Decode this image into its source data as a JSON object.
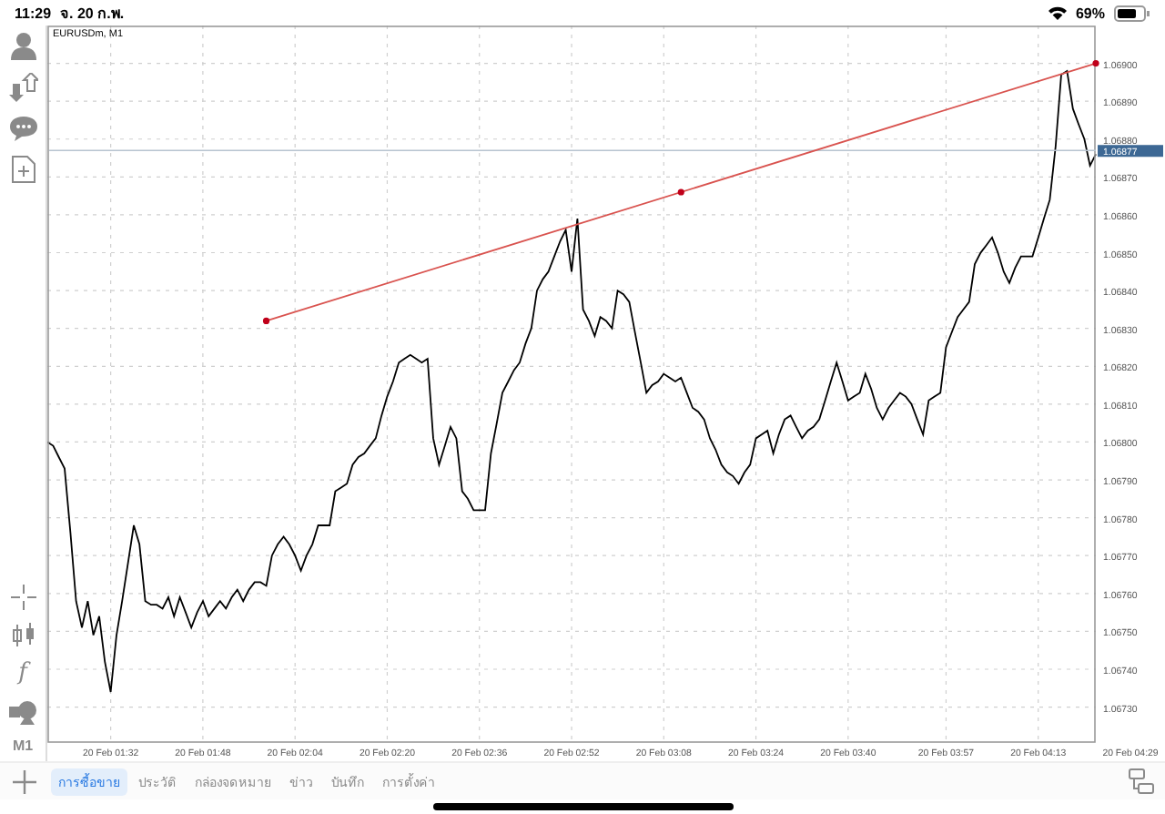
{
  "status_bar": {
    "time": "11:29",
    "date": "จ. 20 ก.พ.",
    "battery": "69%"
  },
  "toolbar": {
    "function_label": "f",
    "timeframe": "M1"
  },
  "chart": {
    "symbol": "EURUSDm, M1",
    "current_price": "1.06877",
    "trendline": {
      "kind": "trendline"
    },
    "chart_data": {
      "type": "line",
      "ylim": [
        1.06721,
        1.0691
      ],
      "grid": true,
      "categories": [
        null,
        null,
        null,
        null,
        null,
        null,
        null,
        null,
        null,
        null,
        null,
        "20 Feb 01:32",
        null,
        null,
        null,
        null,
        null,
        null,
        null,
        null,
        null,
        null,
        null,
        null,
        null,
        null,
        null,
        "20 Feb 01:48",
        null,
        null,
        null,
        null,
        null,
        null,
        null,
        null,
        null,
        null,
        null,
        null,
        null,
        null,
        null,
        "20 Feb 02:04",
        null,
        null,
        null,
        null,
        null,
        null,
        null,
        null,
        null,
        null,
        null,
        null,
        null,
        null,
        null,
        "20 Feb 02:20",
        null,
        null,
        null,
        null,
        null,
        null,
        null,
        null,
        null,
        null,
        null,
        null,
        null,
        null,
        null,
        "20 Feb 02:36",
        null,
        null,
        null,
        null,
        null,
        null,
        null,
        null,
        null,
        null,
        null,
        null,
        null,
        null,
        null,
        "20 Feb 02:52",
        null,
        null,
        null,
        null,
        null,
        null,
        null,
        null,
        null,
        null,
        null,
        null,
        null,
        null,
        null,
        "20 Feb 03:08",
        null,
        null,
        null,
        null,
        null,
        null,
        null,
        null,
        null,
        null,
        null,
        null,
        null,
        null,
        null,
        "20 Feb 03:24",
        null,
        null,
        null,
        null,
        null,
        null,
        null,
        null,
        null,
        null,
        null,
        null,
        null,
        null,
        null,
        "20 Feb 03:40",
        null,
        null,
        null,
        null,
        null,
        null,
        null,
        null,
        null,
        null,
        null,
        null,
        null,
        null,
        null,
        null,
        "20 Feb 03:57",
        null,
        null,
        null,
        null,
        null,
        null,
        null,
        null,
        null,
        null,
        null,
        null,
        null,
        null,
        null,
        "20 Feb 04:13",
        null,
        null,
        null,
        null,
        null,
        null,
        null,
        null,
        null,
        null,
        null,
        null,
        null,
        null,
        null,
        "20 Feb 04:29"
      ],
      "series": [
        {
          "color": "#000000",
          "values": [
            1.068,
            1.06799,
            1.06796,
            1.06793,
            1.06776,
            1.06758,
            1.06751,
            1.06758,
            1.06749,
            1.06754,
            1.06742,
            1.06734,
            1.06749,
            1.06758,
            1.06768,
            1.06778,
            1.06773,
            1.06758,
            1.06757,
            1.06757,
            1.06756,
            1.06759,
            1.06754,
            1.06759,
            1.06755,
            1.06751,
            1.06755,
            1.06758,
            1.06754,
            1.06756,
            1.06758,
            1.06756,
            1.06759,
            1.06761,
            1.06758,
            1.06761,
            1.06763,
            1.06763,
            1.06762,
            1.0677,
            1.06773,
            1.06775,
            1.06773,
            1.0677,
            1.06766,
            1.0677,
            1.06773,
            1.06778,
            1.06778,
            1.06778,
            1.06787,
            1.06788,
            1.06789,
            1.06794,
            1.06796,
            1.06797,
            1.06799,
            1.06801,
            1.06807,
            1.06812,
            1.06816,
            1.06821,
            1.06822,
            1.06823,
            1.06822,
            1.06821,
            1.06822,
            1.06801,
            1.06794,
            1.06799,
            1.06804,
            1.06801,
            1.06787,
            1.06785,
            1.06782,
            1.06782,
            1.06782,
            1.06797,
            1.06805,
            1.06813,
            1.06816,
            1.06819,
            1.06821,
            1.06826,
            1.0683,
            1.0684,
            1.06843,
            1.06845,
            1.06849,
            1.06853,
            1.06856,
            1.06845,
            1.06859,
            1.06835,
            1.06832,
            1.06828,
            1.06833,
            1.06832,
            1.0683,
            1.0684,
            1.06839,
            1.06837,
            1.06829,
            1.06821,
            1.06813,
            1.06815,
            1.06816,
            1.06818,
            1.06817,
            1.06816,
            1.06817,
            1.06813,
            1.06809,
            1.06808,
            1.06806,
            1.06801,
            1.06798,
            1.06794,
            1.06792,
            1.06791,
            1.06789,
            1.06792,
            1.06794,
            1.06801,
            1.06802,
            1.06803,
            1.06797,
            1.06802,
            1.06806,
            1.06807,
            1.06804,
            1.06801,
            1.06803,
            1.06804,
            1.06806,
            1.06811,
            1.06816,
            1.06821,
            1.06816,
            1.06811,
            1.06812,
            1.06813,
            1.06818,
            1.06814,
            1.06809,
            1.06806,
            1.06809,
            1.06811,
            1.06813,
            1.06812,
            1.0681,
            1.06806,
            1.06802,
            1.06811,
            1.06812,
            1.06813,
            1.06825,
            1.06829,
            1.06833,
            1.06835,
            1.06837,
            1.06847,
            1.0685,
            1.06852,
            1.06854,
            1.0685,
            1.06845,
            1.06842,
            1.06846,
            1.06849,
            1.06849,
            1.06849,
            1.06854,
            1.06859,
            1.06864,
            1.06878,
            1.06897,
            1.06898,
            1.06888,
            1.06884,
            1.0688,
            1.06873,
            1.06876,
            null,
            null,
            null,
            null,
            null,
            null
          ]
        }
      ],
      "yticks": [
        {
          "value": 1.069,
          "label": "1.06900"
        },
        {
          "value": 1.0689,
          "label": "1.06890"
        },
        {
          "value": 1.0688,
          "label": "1.06880"
        },
        {
          "value": 1.0687,
          "label": "1.06870"
        },
        {
          "value": 1.0686,
          "label": "1.06860"
        },
        {
          "value": 1.0685,
          "label": "1.06850"
        },
        {
          "value": 1.0684,
          "label": "1.06840"
        },
        {
          "value": 1.0683,
          "label": "1.06830"
        },
        {
          "value": 1.0682,
          "label": "1.06820"
        },
        {
          "value": 1.0681,
          "label": "1.06810"
        },
        {
          "value": 1.068,
          "label": "1.06800"
        },
        {
          "value": 1.0679,
          "label": "1.06790"
        },
        {
          "value": 1.0678,
          "label": "1.06780"
        },
        {
          "value": 1.0677,
          "label": "1.06770"
        },
        {
          "value": 1.0676,
          "label": "1.06760"
        },
        {
          "value": 1.0675,
          "label": "1.06750"
        },
        {
          "value": 1.0674,
          "label": "1.06740"
        },
        {
          "value": 1.0673,
          "label": "1.06730"
        }
      ]
    }
  },
  "tabs": [
    {
      "label": "การซื้อขาย",
      "selected": true
    },
    {
      "label": "ประวัติ",
      "selected": false
    },
    {
      "label": "กล่องจดหมาย",
      "selected": false
    },
    {
      "label": "ข่าว",
      "selected": false
    },
    {
      "label": "บันทึก",
      "selected": false
    },
    {
      "label": "การตั้งค่า",
      "selected": false
    }
  ]
}
